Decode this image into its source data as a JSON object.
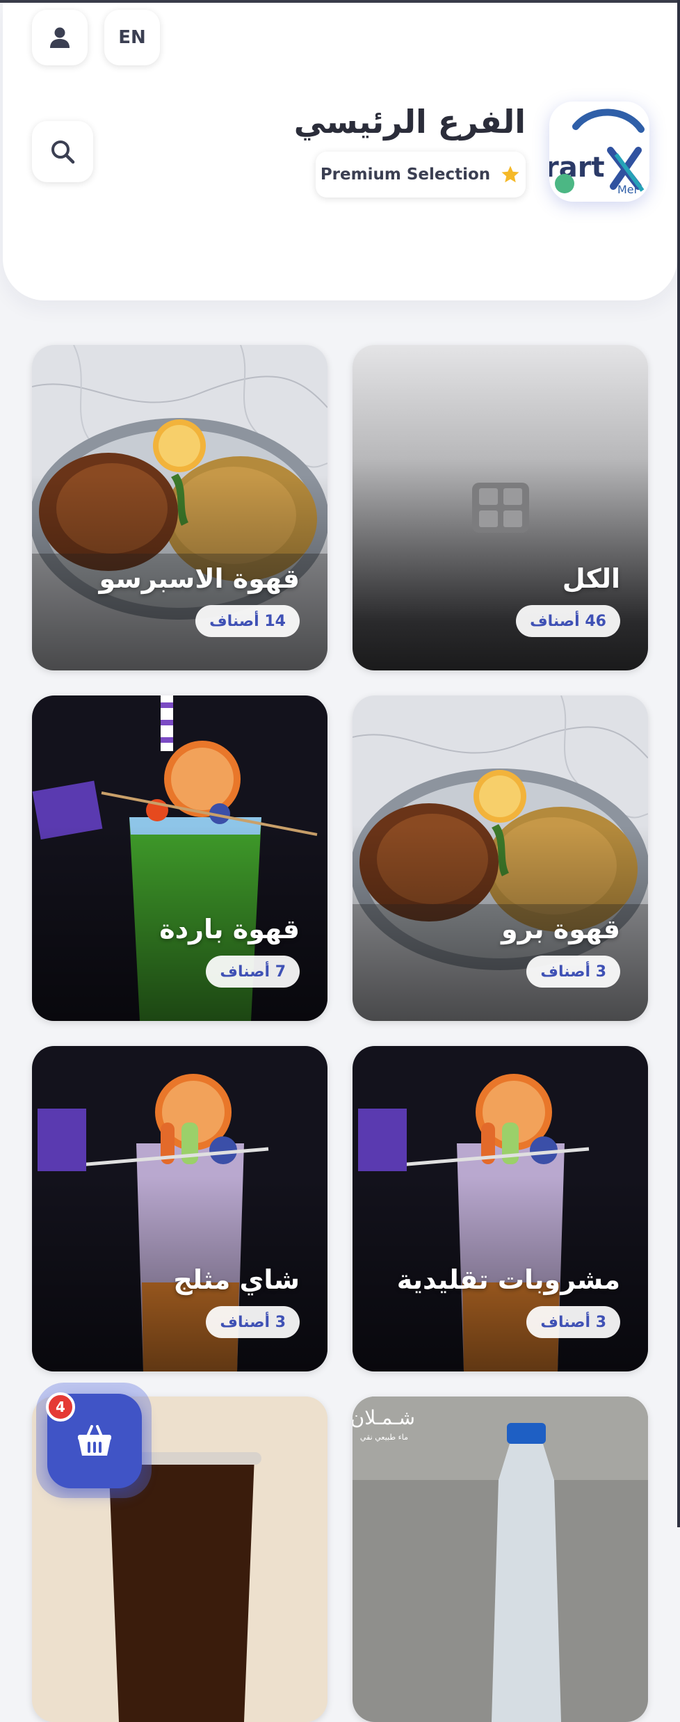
{
  "header": {
    "lang_toggle": "EN",
    "branch_title": "الفرع الرئيسي",
    "badge_label": "Premium Selection",
    "logo_letters": "rart",
    "logo_sub": "Mer"
  },
  "categories": [
    {
      "title": "الكل",
      "count": "46 أصناف"
    },
    {
      "title": "قهوة الاسبرسو",
      "count": "14 أصناف"
    },
    {
      "title": "قهوة برو",
      "count": "3 أصناف"
    },
    {
      "title": "قهوة باردة",
      "count": "7 أصناف"
    },
    {
      "title": "مشروبات تقليدية",
      "count": "3 أصناف"
    },
    {
      "title": "شاي مثلج",
      "count": "3 أصناف"
    },
    {
      "brand": "شـمـلان",
      "brand_sub": "ماء طبيعي نقي"
    }
  ],
  "cart": {
    "count": "4"
  },
  "colors": {
    "accent": "#3f51b5",
    "cart": "#4054c6",
    "badge": "#e53935",
    "star": "#f5b928"
  }
}
